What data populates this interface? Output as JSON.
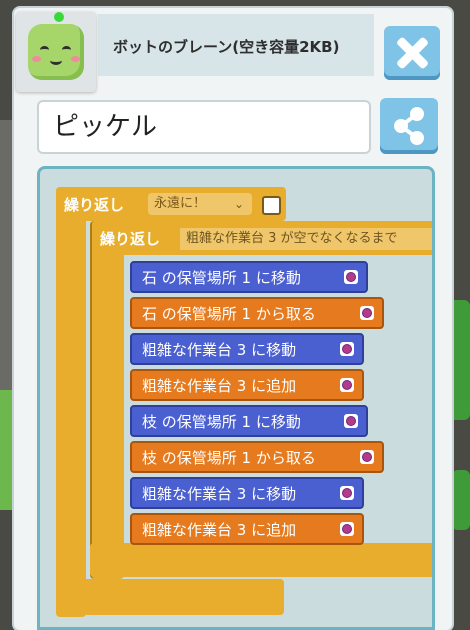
{
  "header": {
    "title": "ボットのブレーン(空き容量2KB)"
  },
  "bot_name": {
    "value": "ピッケル"
  },
  "icons": {
    "close": "close-icon",
    "share": "share-icon",
    "target": "target-icon",
    "dropdown": "chevron-down-icon"
  },
  "colors": {
    "loop": "#e8ad2c",
    "move_block": "#4a5fd0",
    "action_block": "#e57a1e",
    "button": "#7fc3e6"
  },
  "program": {
    "outer_loop": {
      "label": "繰り返し",
      "mode": "永遠に！",
      "arrow": "⌄"
    },
    "inner_loop": {
      "label": "繰り返し",
      "condition": "粗雑な作業台 3 が空でなくなるまで"
    },
    "commands": [
      {
        "text": "石 の保管場所 1 に移動",
        "kind": "move"
      },
      {
        "text": "石 の保管場所 1 から取る",
        "kind": "action"
      },
      {
        "text": "粗雑な作業台 3 に移動",
        "kind": "move"
      },
      {
        "text": "粗雑な作業台 3 に追加",
        "kind": "action"
      },
      {
        "text": "枝 の保管場所 1 に移動",
        "kind": "move"
      },
      {
        "text": "枝 の保管場所 1 から取る",
        "kind": "action"
      },
      {
        "text": "粗雑な作業台 3 に移動",
        "kind": "move"
      },
      {
        "text": "粗雑な作業台 3 に追加",
        "kind": "action"
      }
    ]
  }
}
